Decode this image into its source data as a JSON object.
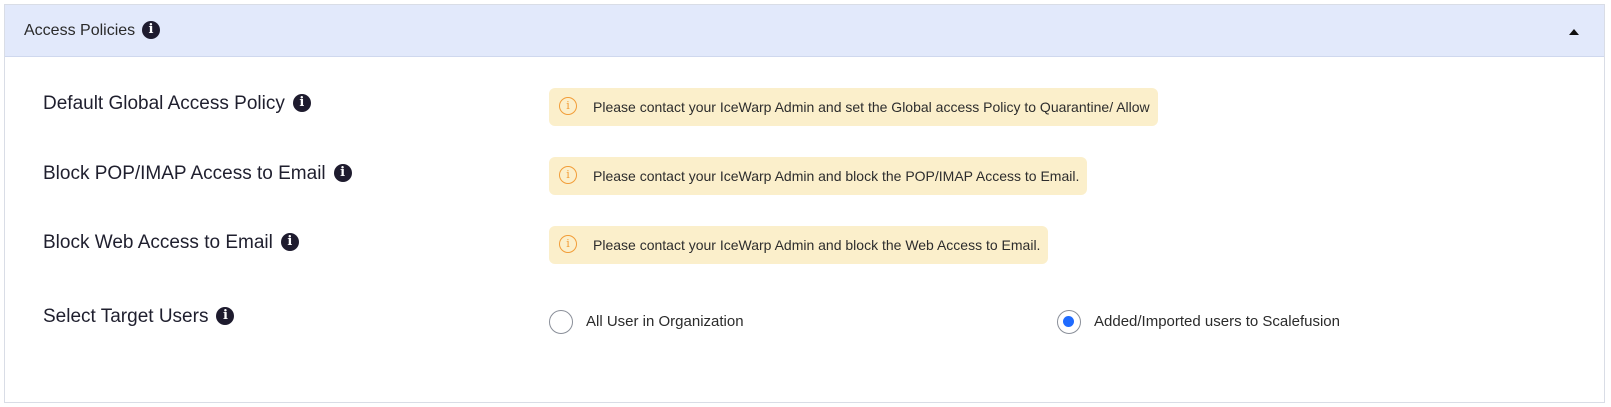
{
  "panel": {
    "title": "Access Policies",
    "info_icon": "info-icon",
    "collapse_icon": "caret-up-icon"
  },
  "rows": [
    {
      "label": "Default Global Access Policy",
      "notice": "Please contact your IceWarp Admin and set the Global access Policy to Quarantine/ Allow"
    },
    {
      "label": "Block POP/IMAP Access to Email",
      "notice": "Please contact your IceWarp Admin and block the POP/IMAP Access to Email."
    },
    {
      "label": "Block Web Access to Email",
      "notice": "Please contact your IceWarp Admin and block the Web Access to Email."
    }
  ],
  "target_users": {
    "label": "Select Target Users",
    "options": [
      {
        "label": "All User in Organization",
        "selected": false
      },
      {
        "label": "Added/Imported users to Scalefusion",
        "selected": true
      }
    ]
  },
  "colors": {
    "header_bg": "#e2e9fb",
    "notice_bg": "#fbefcb",
    "warning_icon": "#f29d38",
    "radio_selected": "#1f6bff"
  },
  "notice_icon": "warning-circle-icon"
}
